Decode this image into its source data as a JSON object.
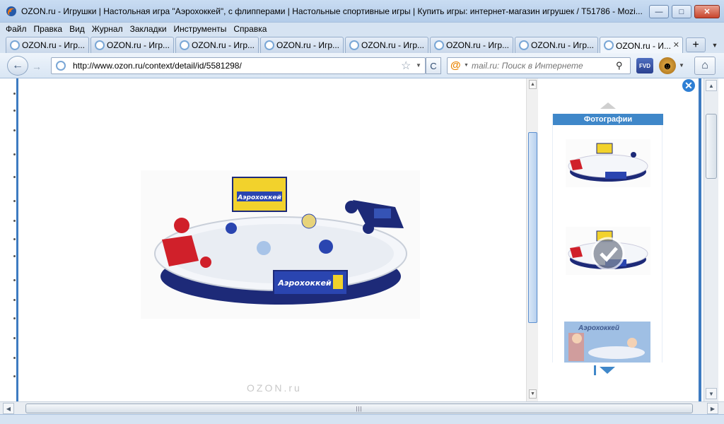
{
  "window": {
    "title": "OZON.ru - Игрушки | Настольная игра \"Аэрохоккей\", с флипперами | Настольные спортивные игры | Купить игры: интернет-магазин игрушек / T51786 - Mozi...",
    "controls": {
      "minimize": "▭",
      "maximize": "☐",
      "close": "✕"
    }
  },
  "menu": [
    "Файл",
    "Правка",
    "Вид",
    "Журнал",
    "Закладки",
    "Инструменты",
    "Справка"
  ],
  "tabs": [
    {
      "label": "OZON.ru - Игр..."
    },
    {
      "label": "OZON.ru - Игр..."
    },
    {
      "label": "OZON.ru - Игр..."
    },
    {
      "label": "OZON.ru - Игр..."
    },
    {
      "label": "OZON.ru - Игр..."
    },
    {
      "label": "OZON.ru - Игр..."
    },
    {
      "label": "OZON.ru - Игр..."
    },
    {
      "label": "OZON.ru - И..."
    }
  ],
  "active_tab_index": 7,
  "new_tab_label": "+",
  "nav": {
    "back": "←",
    "forward": "→",
    "url": "http://www.ozon.ru/context/detail/id/5581298/",
    "reload": "C",
    "search_placeholder": "mail.ru: Поиск в Интернете",
    "addon_label": "FVD",
    "home": "⌂"
  },
  "product_images": {
    "main_board_text": "Аэрохоккей",
    "watermark": "OZON.ru"
  },
  "gallery": {
    "header": "Фотографии",
    "thumb3_label": "Аэрохоккей",
    "close": "✕"
  },
  "colors": {
    "accent_blue": "#3d7bc1",
    "gallery_header": "#3f87c9",
    "table_red": "#d0202a",
    "table_navy": "#1d2a78",
    "board_yellow": "#f2d22c"
  }
}
